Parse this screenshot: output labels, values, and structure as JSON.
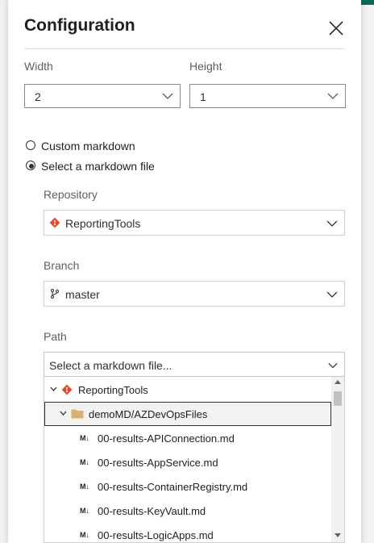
{
  "dialog": {
    "title": "Configuration",
    "width_label": "Width",
    "width_value": "2",
    "height_label": "Height",
    "height_value": "1",
    "radio_custom": "Custom markdown",
    "radio_file": "Select a markdown file",
    "selected_option": "Select a markdown file",
    "repository_label": "Repository",
    "repository_value": "ReportingTools",
    "branch_label": "Branch",
    "branch_value": "master",
    "path_label": "Path",
    "path_placeholder": "Select a markdown file..."
  },
  "tree": {
    "root": "ReportingTools",
    "folder": "demoMD/AZDevOpsFiles",
    "md_badge": "M↓",
    "files": [
      "00-results-APIConnection.md",
      "00-results-AppService.md",
      "00-results-ContainerRegistry.md",
      "00-results-KeyVault.md",
      "00-results-LogicApps.md"
    ]
  },
  "colors": {
    "git_orange": "#e8472a",
    "folder_tan": "#d9b26f",
    "accent_green": "#0b6a53"
  }
}
